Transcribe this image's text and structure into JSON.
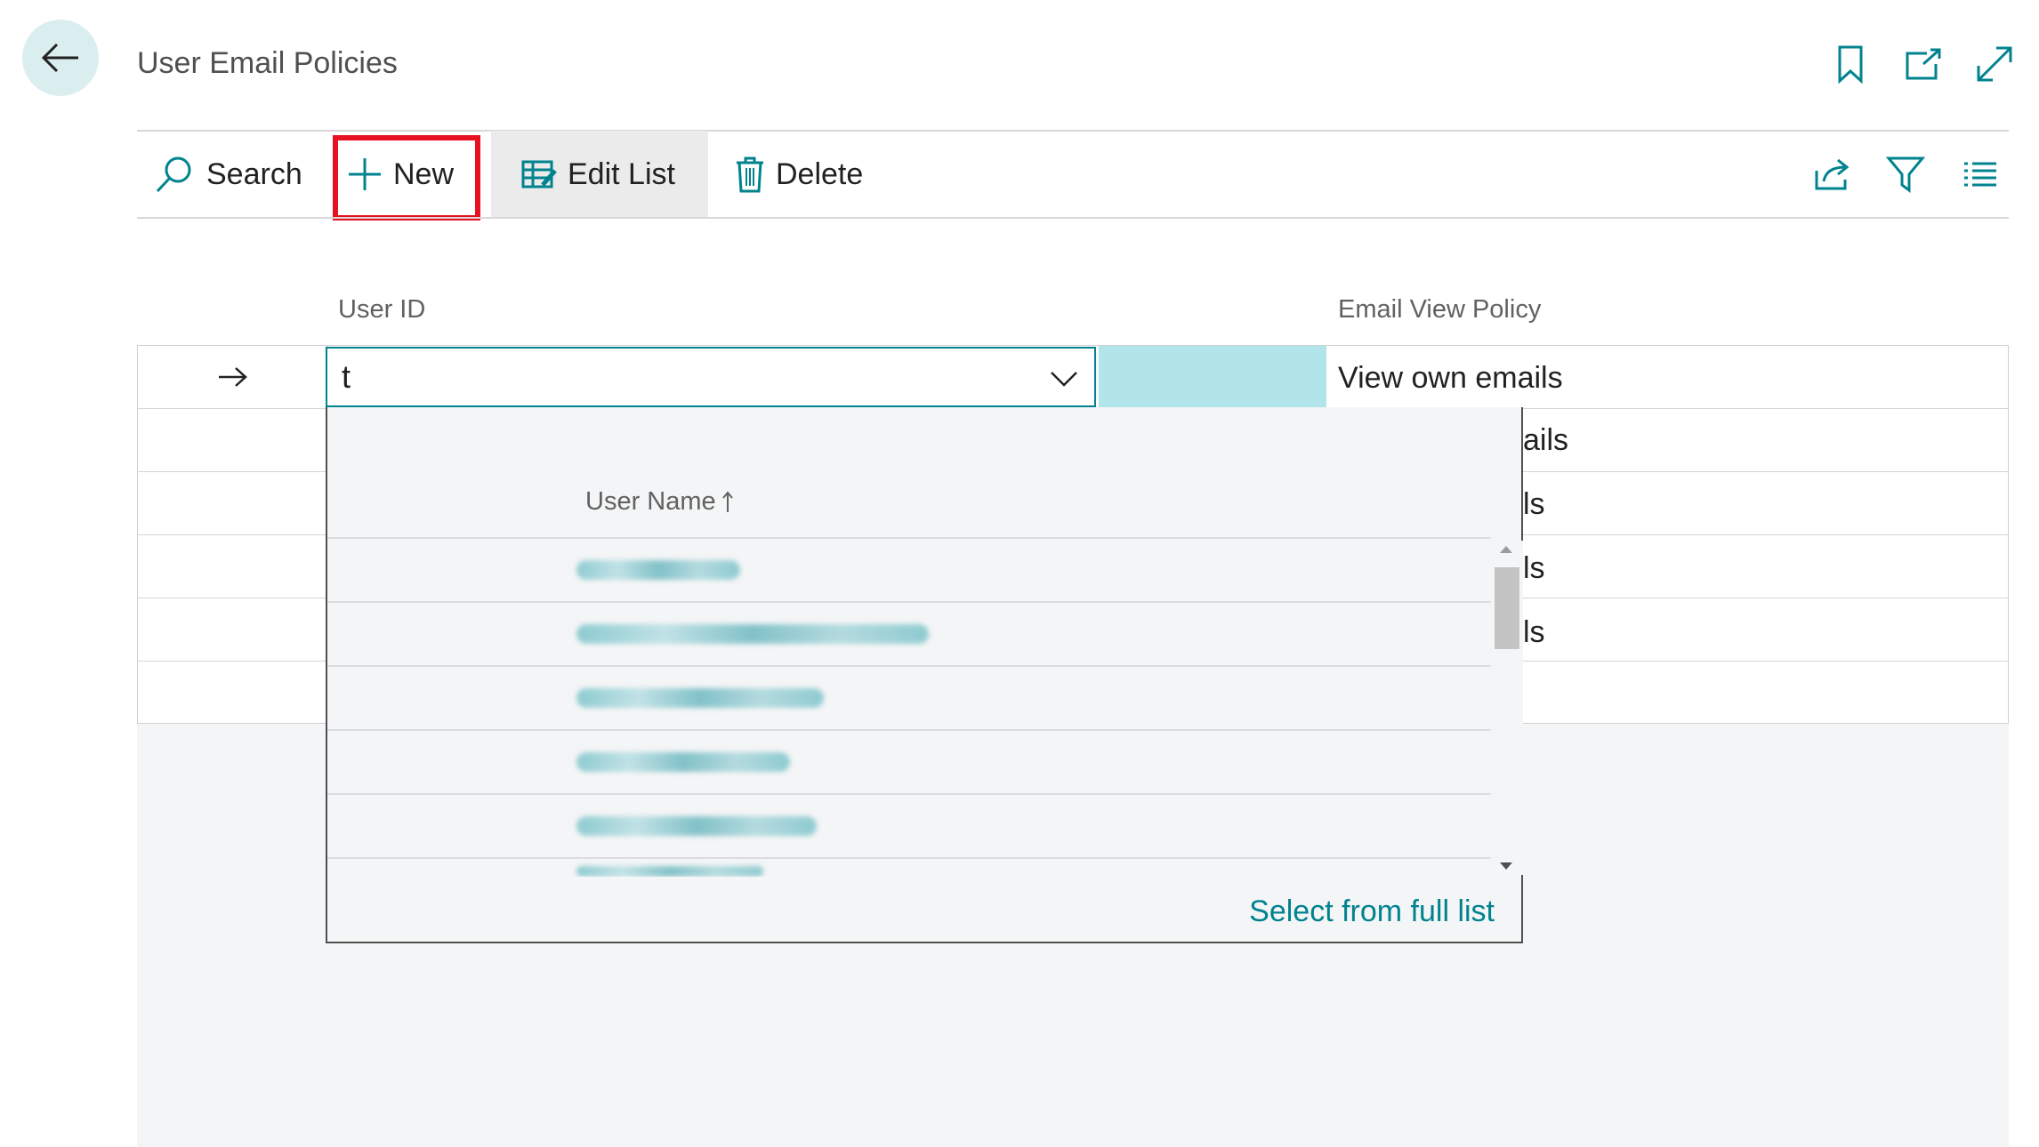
{
  "header": {
    "title": "User Email Policies"
  },
  "actions": {
    "search_label": "Search",
    "new_label": "New",
    "edit_list_label": "Edit List",
    "delete_label": "Delete"
  },
  "columns": {
    "user_id": "User ID",
    "email_view_policy": "Email View Policy"
  },
  "rows": [
    {
      "policy": "View own emails"
    },
    {
      "policy_partial": "ails"
    },
    {
      "policy_partial": "ls"
    },
    {
      "policy_partial": "ls"
    },
    {
      "policy_partial": "ls"
    },
    {
      "policy_partial": ""
    }
  ],
  "current_input": {
    "value": "t"
  },
  "lookup": {
    "column_header": "User Name",
    "select_full_list": "Select from full list"
  },
  "colors": {
    "accent": "#00838f",
    "highlight_border": "#e81123",
    "back_button_bg": "#daeef0",
    "selected_cell": "#b2e5ea"
  },
  "icons": [
    "back-arrow-icon",
    "bookmark-icon",
    "open-new-window-icon",
    "expand-icon",
    "search-icon",
    "plus-icon",
    "edit-list-icon",
    "delete-icon",
    "share-icon",
    "filter-icon",
    "list-view-icon",
    "row-arrow-icon",
    "chevron-down-icon",
    "sort-ascending-icon"
  ]
}
